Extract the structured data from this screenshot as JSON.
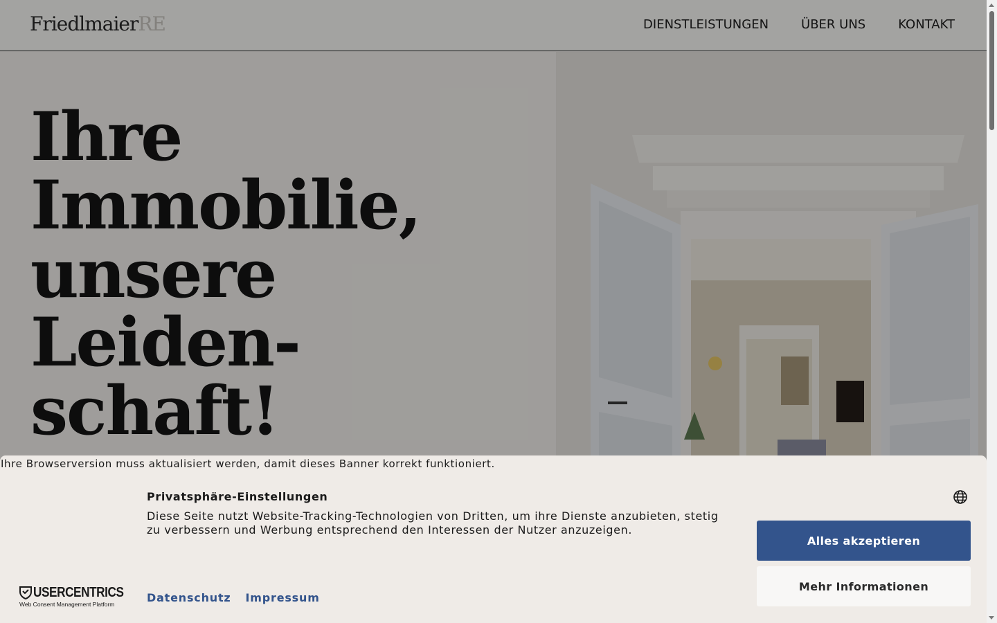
{
  "header": {
    "logo_main": "Friedlmaier",
    "logo_suffix": "RE",
    "nav": [
      "DIENSTLEISTUNGEN",
      "ÜBER UNS",
      "KONTAKT"
    ]
  },
  "hero": {
    "title_lines": [
      "Ihre",
      "Immobilie,",
      "unsere",
      "Leiden-",
      "schaft!"
    ]
  },
  "consent": {
    "browser_warning": "Ihre Browserversion muss aktualisiert werden, damit dieses Banner korrekt funktioniert.",
    "title": "Privatsphäre-Einstellungen",
    "text": "Diese Seite nutzt Website-Tracking-Technologien von Dritten, um ihre Dienste anzubieten, stetig zu verbessern und Werbung entsprechend den Interessen der Nutzer anzuzeigen.",
    "accept_label": "Alles akzeptieren",
    "more_label": "Mehr Informationen",
    "links": [
      "Datenschutz",
      "Impressum"
    ],
    "brand": "USERCENTRICS",
    "brand_sub": "Web Consent Management Platform",
    "language_icon": "globe-icon",
    "colors": {
      "primary": "#33548c",
      "banner_bg": "#efebe7"
    }
  }
}
